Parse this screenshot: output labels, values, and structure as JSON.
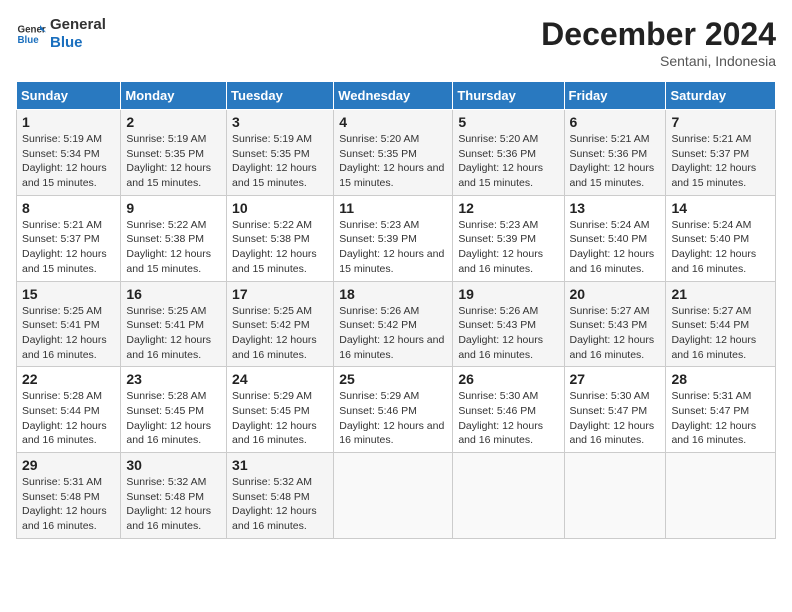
{
  "header": {
    "logo_line1": "General",
    "logo_line2": "Blue",
    "month": "December 2024",
    "location": "Sentani, Indonesia"
  },
  "weekdays": [
    "Sunday",
    "Monday",
    "Tuesday",
    "Wednesday",
    "Thursday",
    "Friday",
    "Saturday"
  ],
  "weeks": [
    [
      {
        "day": "1",
        "info": "Sunrise: 5:19 AM\nSunset: 5:34 PM\nDaylight: 12 hours and 15 minutes."
      },
      {
        "day": "2",
        "info": "Sunrise: 5:19 AM\nSunset: 5:35 PM\nDaylight: 12 hours and 15 minutes."
      },
      {
        "day": "3",
        "info": "Sunrise: 5:19 AM\nSunset: 5:35 PM\nDaylight: 12 hours and 15 minutes."
      },
      {
        "day": "4",
        "info": "Sunrise: 5:20 AM\nSunset: 5:35 PM\nDaylight: 12 hours and 15 minutes."
      },
      {
        "day": "5",
        "info": "Sunrise: 5:20 AM\nSunset: 5:36 PM\nDaylight: 12 hours and 15 minutes."
      },
      {
        "day": "6",
        "info": "Sunrise: 5:21 AM\nSunset: 5:36 PM\nDaylight: 12 hours and 15 minutes."
      },
      {
        "day": "7",
        "info": "Sunrise: 5:21 AM\nSunset: 5:37 PM\nDaylight: 12 hours and 15 minutes."
      }
    ],
    [
      {
        "day": "8",
        "info": "Sunrise: 5:21 AM\nSunset: 5:37 PM\nDaylight: 12 hours and 15 minutes."
      },
      {
        "day": "9",
        "info": "Sunrise: 5:22 AM\nSunset: 5:38 PM\nDaylight: 12 hours and 15 minutes."
      },
      {
        "day": "10",
        "info": "Sunrise: 5:22 AM\nSunset: 5:38 PM\nDaylight: 12 hours and 15 minutes."
      },
      {
        "day": "11",
        "info": "Sunrise: 5:23 AM\nSunset: 5:39 PM\nDaylight: 12 hours and 15 minutes."
      },
      {
        "day": "12",
        "info": "Sunrise: 5:23 AM\nSunset: 5:39 PM\nDaylight: 12 hours and 16 minutes."
      },
      {
        "day": "13",
        "info": "Sunrise: 5:24 AM\nSunset: 5:40 PM\nDaylight: 12 hours and 16 minutes."
      },
      {
        "day": "14",
        "info": "Sunrise: 5:24 AM\nSunset: 5:40 PM\nDaylight: 12 hours and 16 minutes."
      }
    ],
    [
      {
        "day": "15",
        "info": "Sunrise: 5:25 AM\nSunset: 5:41 PM\nDaylight: 12 hours and 16 minutes."
      },
      {
        "day": "16",
        "info": "Sunrise: 5:25 AM\nSunset: 5:41 PM\nDaylight: 12 hours and 16 minutes."
      },
      {
        "day": "17",
        "info": "Sunrise: 5:25 AM\nSunset: 5:42 PM\nDaylight: 12 hours and 16 minutes."
      },
      {
        "day": "18",
        "info": "Sunrise: 5:26 AM\nSunset: 5:42 PM\nDaylight: 12 hours and 16 minutes."
      },
      {
        "day": "19",
        "info": "Sunrise: 5:26 AM\nSunset: 5:43 PM\nDaylight: 12 hours and 16 minutes."
      },
      {
        "day": "20",
        "info": "Sunrise: 5:27 AM\nSunset: 5:43 PM\nDaylight: 12 hours and 16 minutes."
      },
      {
        "day": "21",
        "info": "Sunrise: 5:27 AM\nSunset: 5:44 PM\nDaylight: 12 hours and 16 minutes."
      }
    ],
    [
      {
        "day": "22",
        "info": "Sunrise: 5:28 AM\nSunset: 5:44 PM\nDaylight: 12 hours and 16 minutes."
      },
      {
        "day": "23",
        "info": "Sunrise: 5:28 AM\nSunset: 5:45 PM\nDaylight: 12 hours and 16 minutes."
      },
      {
        "day": "24",
        "info": "Sunrise: 5:29 AM\nSunset: 5:45 PM\nDaylight: 12 hours and 16 minutes."
      },
      {
        "day": "25",
        "info": "Sunrise: 5:29 AM\nSunset: 5:46 PM\nDaylight: 12 hours and 16 minutes."
      },
      {
        "day": "26",
        "info": "Sunrise: 5:30 AM\nSunset: 5:46 PM\nDaylight: 12 hours and 16 minutes."
      },
      {
        "day": "27",
        "info": "Sunrise: 5:30 AM\nSunset: 5:47 PM\nDaylight: 12 hours and 16 minutes."
      },
      {
        "day": "28",
        "info": "Sunrise: 5:31 AM\nSunset: 5:47 PM\nDaylight: 12 hours and 16 minutes."
      }
    ],
    [
      {
        "day": "29",
        "info": "Sunrise: 5:31 AM\nSunset: 5:48 PM\nDaylight: 12 hours and 16 minutes."
      },
      {
        "day": "30",
        "info": "Sunrise: 5:32 AM\nSunset: 5:48 PM\nDaylight: 12 hours and 16 minutes."
      },
      {
        "day": "31",
        "info": "Sunrise: 5:32 AM\nSunset: 5:48 PM\nDaylight: 12 hours and 16 minutes."
      },
      null,
      null,
      null,
      null
    ]
  ]
}
